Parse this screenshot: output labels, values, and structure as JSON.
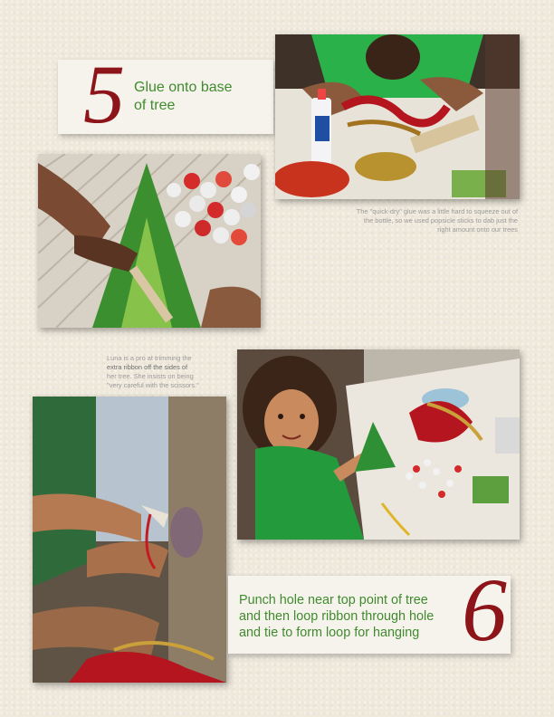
{
  "steps": [
    {
      "number": "5",
      "text_line1": "Glue onto base",
      "text_line2": "of tree"
    },
    {
      "number": "6",
      "text_line1": "Punch hole near top point of tree",
      "text_line2": "and then loop ribbon through hole",
      "text_line3": "and tie to form loop for hanging"
    }
  ],
  "captions": {
    "glue": {
      "line1": "The \"quick-dry\" glue was a little hard to squeeze out of",
      "line2": "the bottle, so we used popsicle sticks to dab just the",
      "line3": "right amount onto our trees"
    },
    "luna": {
      "line1": "Luna is a pro at trimming the",
      "line2_strong": "extra ribbon off the sides of",
      "line3": "her tree. She insists on being",
      "line4": "\"very careful with the scissors.\""
    }
  },
  "photos": [
    {
      "name": "glue-table-photo"
    },
    {
      "name": "buttons-tree-photo"
    },
    {
      "name": "luna-scissors-photo"
    },
    {
      "name": "ribbon-hands-photo"
    }
  ],
  "colors": {
    "accent_red": "#8d1419",
    "accent_green": "#3f8b2e",
    "background": "#efe9dc"
  }
}
